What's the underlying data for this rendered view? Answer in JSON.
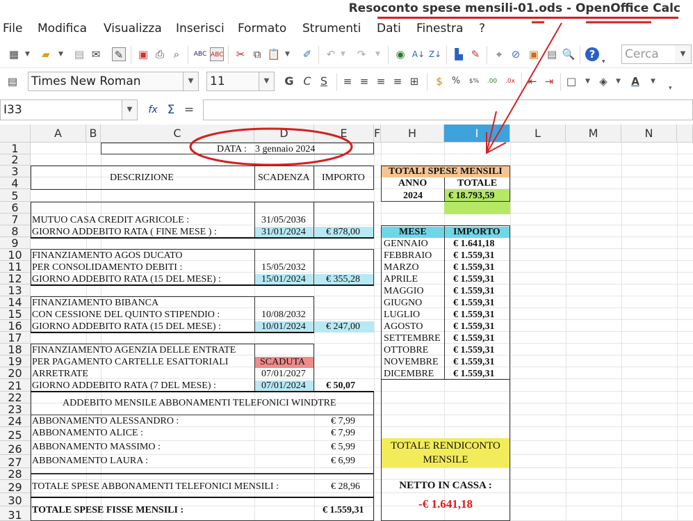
{
  "window": {
    "title": "Resoconto spese mensili-01.ods - OpenOffice Calc"
  },
  "menu": [
    "File",
    "Modifica",
    "Visualizza",
    "Inserisci",
    "Formato",
    "Strumenti",
    "Dati",
    "Finestra",
    "?"
  ],
  "toolbar": {
    "search_placeholder": "Cerca"
  },
  "format_toolbar": {
    "font_name": "Times New Roman",
    "font_size": "11",
    "bold": "G",
    "italic": "C",
    "underline": "S"
  },
  "formula_bar": {
    "cell_ref": "I33",
    "content": ""
  },
  "columns": [
    "A",
    "B",
    "C",
    "D",
    "E",
    "F",
    "H",
    "I",
    "L",
    "M",
    "N"
  ],
  "rows": [
    "1",
    "2",
    "3",
    "4",
    "5",
    "6",
    "7",
    "8",
    "9",
    "10",
    "11",
    "12",
    "13",
    "14",
    "15",
    "16",
    "17",
    "18",
    "19",
    "20",
    "21",
    "22",
    "23",
    "24",
    "25",
    "26",
    "27",
    "28",
    "29",
    "30",
    "31"
  ],
  "sheet": {
    "date_label": "DATA :",
    "date_value": "3 gennaio 2024",
    "hdr_descrizione": "DESCRIZIONE",
    "hdr_scadenza": "SCADENZA",
    "hdr_importo": "IMPORTO",
    "r7_desc": "MUTUO CASA CREDIT AGRICOLE :",
    "r7_date": "31/05/2036",
    "r8_desc": "GIORNO ADDEBITO RATA ( FINE MESE ) :",
    "r8_date": "31/01/2024",
    "r8_amt": "€ 878,00",
    "r10_desc": "FINANZIAMENTO AGOS DUCATO",
    "r11_desc": "PER CONSOLIDAMENTO DEBITI :",
    "r11_date": "15/05/2032",
    "r12_desc": "GIORNO ADDEBITO RATA  (15 DEL MESE) :",
    "r12_date": "15/01/2024",
    "r12_amt": "€ 355,28",
    "r14_desc": "FINANZIAMENTO BIBANCA",
    "r15_desc": "CON CESSIONE DEL QUINTO STIPENDIO :",
    "r15_date": "10/08/2032",
    "r16_desc": "GIORNO ADDEBITO RATA  (15 DEL MESE) :",
    "r16_date": "10/01/2024",
    "r16_amt": "€ 247,00",
    "r18_desc": "FINANZIAMENTO AGENZIA DELLE ENTRATE",
    "r19_desc": "PER PAGAMENTO CARTELLE ESATTORIALI",
    "r19_status": "SCADUTA",
    "r20_desc": "ARRETRATE",
    "r20_date": "07/01/2027",
    "r21_desc": "GIORNO ADDEBITO RATA  (7 DEL MESE) :",
    "r21_date": "07/01/2024",
    "r21_amt": "€ 50,07",
    "r22_title": "ADDEBITO MENSILE ABBONAMENTI TELEFONICI WINDTRE",
    "r24_desc": "ABBONAMENTO ALESSANDRO :",
    "r24_amt": "€ 7,99",
    "r25_desc": "ABBONAMENTO ALICE :",
    "r25_amt": "€ 7,99",
    "r26_desc": "ABBONAMENTO MASSIMO :",
    "r26_amt": "€ 5,99",
    "r27_desc": "ABBONAMENTO LAURA :",
    "r27_amt": "€ 6,99",
    "r29_desc": "TOTALE SPESE ABBONAMENTI TELEFONICI MENSILI :",
    "r29_amt": "€ 28,96",
    "r31_desc": "TOTALE SPESE FISSE MENSILI :",
    "r31_amt": "€ 1.559,31"
  },
  "summary": {
    "title": "TOTALI SPESE MENSILI",
    "anno_label": "ANNO",
    "totale_label": "TOTALE",
    "anno": "2024",
    "totale": "€ 18.793,59",
    "mese_label": "MESE",
    "importo_label": "IMPORTO",
    "months": [
      {
        "m": "GENNAIO",
        "v": "€ 1.641,18"
      },
      {
        "m": "FEBBRAIO",
        "v": "€ 1.559,31"
      },
      {
        "m": "MARZO",
        "v": "€ 1.559,31"
      },
      {
        "m": "APRILE",
        "v": "€ 1.559,31"
      },
      {
        "m": "MAGGIO",
        "v": "€ 1.559,31"
      },
      {
        "m": "GIUGNO",
        "v": "€ 1.559,31"
      },
      {
        "m": "LUGLIO",
        "v": "€ 1.559,31"
      },
      {
        "m": "AGOSTO",
        "v": "€ 1.559,31"
      },
      {
        "m": "SETTEMBRE",
        "v": "€ 1.559,31"
      },
      {
        "m": "OTTOBRE",
        "v": "€ 1.559,31"
      },
      {
        "m": "NOVEMBRE",
        "v": "€ 1.559,31"
      },
      {
        "m": "DICEMBRE",
        "v": "€ 1.559,31"
      }
    ],
    "rendiconto_line1": "TOTALE RENDICONTO",
    "rendiconto_line2": "MENSILE",
    "netto_label": "NETTO IN CASSA :",
    "netto_value": "-€ 1.641,18"
  },
  "colors": {
    "blue_cell": "#b7e9f4",
    "red_cell": "#f08b8b",
    "orange_hdr": "#f6c490",
    "cyan_hdr": "#6fd6e8",
    "green_cell": "#b5e865",
    "yellow_cell": "#f2ec5a",
    "annotation": "#d42020"
  }
}
